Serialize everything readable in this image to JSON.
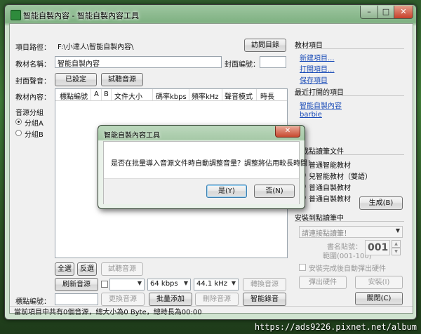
{
  "window": {
    "title": "智能自製內容 - 智能自製內容工具",
    "min": "–",
    "max": "□",
    "close": "✕"
  },
  "project_path": {
    "label": "項目路徑：",
    "value": "F:\\小達人\\智能自製內容\\",
    "visit_button": "訪問目錄"
  },
  "textbook_name": {
    "label": "教材名稱：",
    "value": "智能自製內容",
    "cover_number_label": "封面編號：",
    "cover_number_value": ""
  },
  "cover_audio": {
    "label": "封面聲音：",
    "set_button": "已設定",
    "test_button": "試聽音源"
  },
  "textbook_content": {
    "label": "教材內容："
  },
  "list": {
    "columns": [
      "標點編號",
      "A",
      "B",
      "文件大小",
      "碼率kbps",
      "頻率kHz",
      "聲音模式",
      "時長"
    ]
  },
  "audio_group": {
    "title": "音源分組",
    "options": [
      "分組A",
      "分組B"
    ],
    "selected": 0
  },
  "bottom": {
    "select_all": "全選",
    "invert": "反選",
    "test_audio": "試聽音源",
    "refresh_audio": "刷新音源",
    "bitrate": "64 kbps",
    "frequency": "44.1 kHz",
    "convert_audio": "轉換音源",
    "mark_number_label": "標點編號：",
    "mark_number_value": "",
    "replace_audio": "更換音源",
    "batch_add": "批量添加",
    "delete_audio": "刪除音源",
    "smart_record": "智能錄音"
  },
  "right": {
    "textbook_section": "教材項目",
    "new_project": "新建項目...",
    "open_project": "打開項目...",
    "save_project": "保存項目",
    "recent_section": "最近打開的項目",
    "recent": [
      "智能自製內容",
      "barbie"
    ],
    "generate_section": "生成點讀筆文件",
    "generate_items": [
      "普通智能教材",
      "兒智能教材（雙語）",
      "普通自製教材",
      "普通自製教材"
    ],
    "generate_button": "生成(B)",
    "install_section": "安裝到點讀筆中",
    "connect_placeholder": "請連接點讀筆！",
    "book_number_label": "書名貼號：",
    "range_label": "範圍(001-100)",
    "book_number_value": "001",
    "auto_eject_label": "安裝完成後自動彈出硬件",
    "eject_button": "彈出硬件",
    "install_button": "安裝(I)",
    "close_button": "關閉(C)"
  },
  "status": "當前項目中共有0個音源，總大小為0 Byte，總時長為00:00",
  "dialog": {
    "title": "智能自製內容工具",
    "message": "是否在批量導入音源文件時自動調整音量？調整將佔用較長時間！",
    "yes": "是(Y)",
    "no": "否(N)",
    "close": "✕"
  },
  "watermark": "https://ads9226.pixnet.net/album"
}
